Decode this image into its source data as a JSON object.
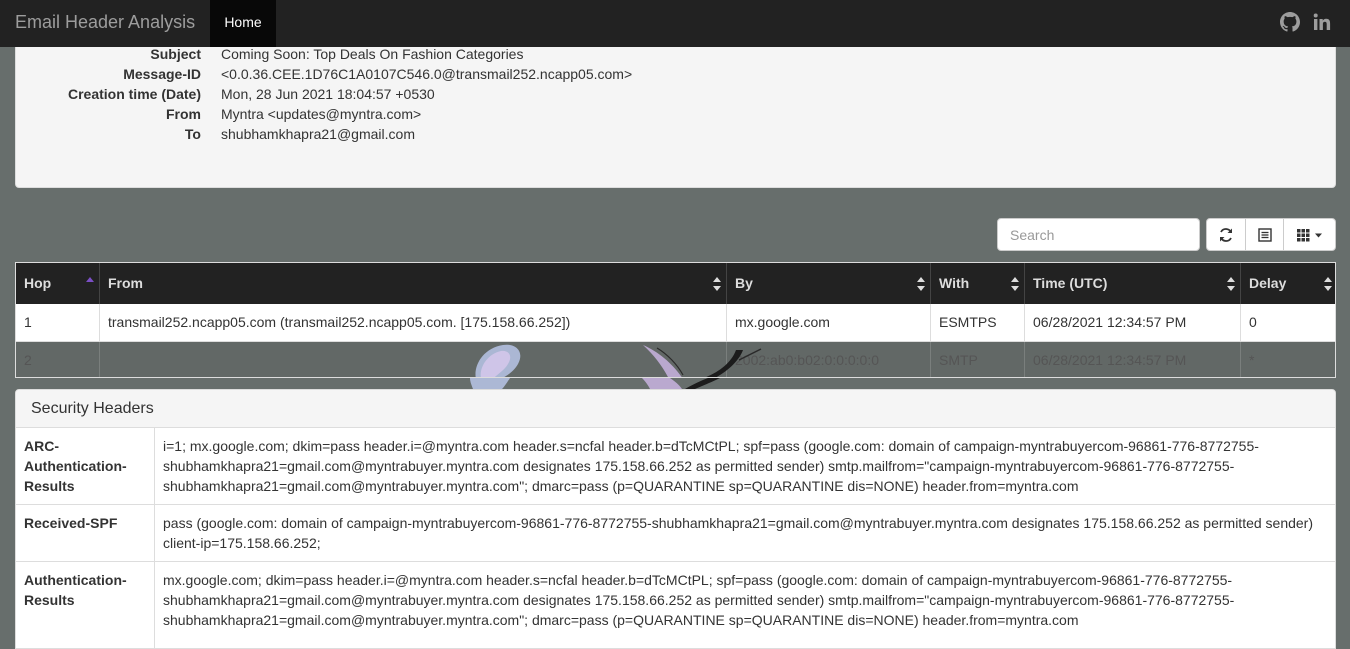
{
  "navbar": {
    "brand": "Email Header Analysis",
    "home_label": "Home",
    "icons": [
      "github-icon",
      "linkedin-icon"
    ]
  },
  "summary": {
    "rows": [
      {
        "key": "Subject",
        "value": "Coming Soon: Top Deals On Fashion Categories"
      },
      {
        "key": "Message-ID",
        "value": "<0.0.36.CEE.1D76C1A0107C546.0@transmail252.ncapp05.com>"
      },
      {
        "key": "Creation time (Date)",
        "value": "Mon, 28 Jun 2021 18:04:57 +0530"
      },
      {
        "key": "From",
        "value": "Myntra <updates@myntra.com>"
      },
      {
        "key": "To",
        "value": "shubhamkhapra21@gmail.com"
      }
    ]
  },
  "toolbar": {
    "search_placeholder": "Search",
    "icons": [
      "refresh-icon",
      "toggle-view-icon",
      "columns-icon"
    ]
  },
  "hops_table": {
    "columns": [
      "Hop",
      "From",
      "By",
      "With",
      "Time (UTC)",
      "Delay"
    ],
    "sorted_column": "Hop",
    "rows": [
      {
        "hop": "1",
        "from": "transmail252.ncapp05.com (transmail252.ncapp05.com. [175.158.66.252])",
        "by": "mx.google.com",
        "with": "ESMTPS",
        "time": "06/28/2021 12:34:57 PM",
        "delay": "0",
        "flag": "india-flag-icon"
      },
      {
        "hop": "2",
        "from": "",
        "by": "2002:ab0:b02:0:0:0:0:0",
        "with": "SMTP",
        "time": "06/28/2021 12:34:57 PM",
        "delay": "*"
      }
    ]
  },
  "security_headers": {
    "title": "Security Headers",
    "rows": [
      {
        "key": "ARC-Authentication-Results",
        "value": "i=1; mx.google.com; dkim=pass header.i=@myntra.com header.s=ncfal header.b=dTcMCtPL; spf=pass (google.com: domain of campaign-myntrabuyercom-96861-776-8772755-shubhamkhapra21=gmail.com@myntrabuyer.myntra.com designates 175.158.66.252 as permitted sender) smtp.mailfrom=\"campaign-myntrabuyercom-96861-776-8772755-shubhamkhapra21=gmail.com@myntrabuyer.myntra.com\"; dmarc=pass (p=QUARANTINE sp=QUARANTINE dis=NONE) header.from=myntra.com"
      },
      {
        "key": "Received-SPF",
        "value": "pass (google.com: domain of campaign-myntrabuyercom-96861-776-8772755-shubhamkhapra21=gmail.com@myntrabuyer.myntra.com designates 175.158.66.252 as permitted sender) client-ip=175.158.66.252;"
      },
      {
        "key": "Authentication-Results",
        "value": "mx.google.com; dkim=pass header.i=@myntra.com header.s=ncfal header.b=dTcMCtPL; spf=pass (google.com: domain of campaign-myntrabuyercom-96861-776-8772755-shubhamkhapra21=gmail.com@myntrabuyer.myntra.com designates 175.158.66.252 as permitted sender) smtp.mailfrom=\"campaign-myntrabuyercom-96861-776-8772755-shubhamkhapra21=gmail.com@myntrabuyer.myntra.com\"; dmarc=pass (p=QUARANTINE sp=QUARANTINE dis=NONE) header.from=myntra.com"
      }
    ]
  },
  "colors": {
    "navbar_bg": "#222222",
    "page_bg": "#676e6c",
    "sort_accent": "#7b4fc6"
  }
}
